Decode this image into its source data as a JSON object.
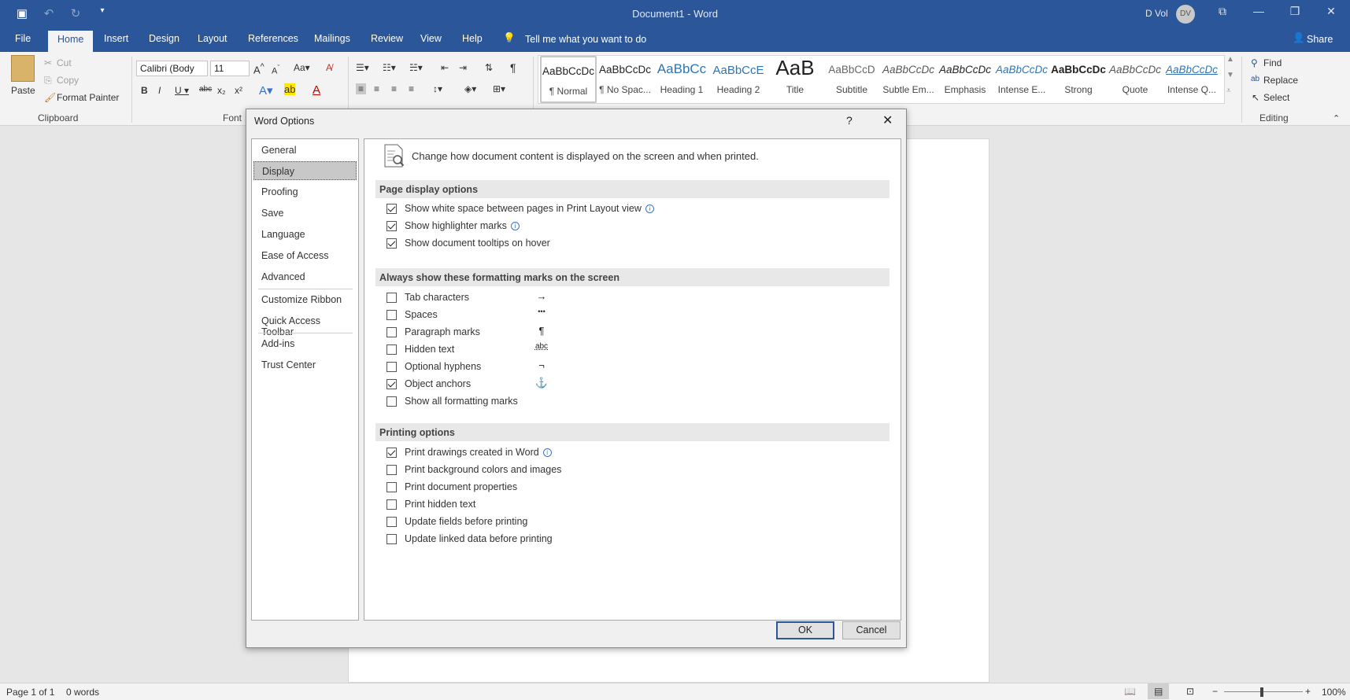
{
  "window": {
    "title": "Document1  -  Word",
    "user_name": "D Vol",
    "user_initials": "DV",
    "qat_icons": [
      "save-icon",
      "undo-icon",
      "redo-icon",
      "customize-qat-icon"
    ],
    "controls": [
      "ribbon-display-icon",
      "minimize-icon",
      "restore-icon",
      "close-icon"
    ]
  },
  "tabs": [
    "File",
    "Home",
    "Insert",
    "Design",
    "Layout",
    "References",
    "Mailings",
    "Review",
    "View",
    "Help"
  ],
  "active_tab": "Home",
  "tell_me": "Tell me what you want to do",
  "share": "Share",
  "ribbon": {
    "clipboard": {
      "paste": "Paste",
      "cut": "Cut",
      "copy": "Copy",
      "format_painter": "Format Painter",
      "label": "Clipboard"
    },
    "font": {
      "name": "Calibri (Body",
      "size": "11",
      "label": "Font"
    },
    "styles": [
      {
        "preview": "AaBbCcDc",
        "name": "¶ Normal"
      },
      {
        "preview": "AaBbCcDc",
        "name": "¶ No Spac..."
      },
      {
        "preview": "AaBbCc",
        "name": "Heading 1"
      },
      {
        "preview": "AaBbCcE",
        "name": "Heading 2"
      },
      {
        "preview": "AaB",
        "name": "Title"
      },
      {
        "preview": "AaBbCcD",
        "name": "Subtitle"
      },
      {
        "preview": "AaBbCcDc",
        "name": "Subtle Em..."
      },
      {
        "preview": "AaBbCcDc",
        "name": "Emphasis"
      },
      {
        "preview": "AaBbCcDc",
        "name": "Intense E..."
      },
      {
        "preview": "AaBbCcDc",
        "name": "Strong"
      },
      {
        "preview": "AaBbCcDc",
        "name": "Quote"
      },
      {
        "preview": "AaBbCcDc",
        "name": "Intense Q..."
      }
    ],
    "editing": {
      "find": "Find",
      "replace": "Replace",
      "select": "Select",
      "label": "Editing"
    }
  },
  "dialog": {
    "title": "Word Options",
    "help": "?",
    "nav": [
      "General",
      "Display",
      "Proofing",
      "Save",
      "Language",
      "Ease of Access",
      "Advanced",
      "Customize Ribbon",
      "Quick Access Toolbar",
      "Add-ins",
      "Trust Center"
    ],
    "selected_nav": "Display",
    "intro": "Change how document content is displayed on the screen and when printed.",
    "sections": {
      "page_display": {
        "title": "Page display options",
        "options": [
          {
            "label": "Show white space between pages in Print Layout view",
            "checked": true,
            "info": true
          },
          {
            "label": "Show highlighter marks",
            "checked": true,
            "info": true
          },
          {
            "label": "Show document tooltips on hover",
            "checked": true,
            "info": false
          }
        ]
      },
      "formatting_marks": {
        "title": "Always show these formatting marks on the screen",
        "options": [
          {
            "label": "Tab characters",
            "checked": false,
            "mark": "→"
          },
          {
            "label": "Spaces",
            "checked": false,
            "mark": "•••"
          },
          {
            "label": "Paragraph marks",
            "checked": false,
            "mark": "¶"
          },
          {
            "label": "Hidden text",
            "checked": false,
            "mark": "abc"
          },
          {
            "label": "Optional hyphens",
            "checked": false,
            "mark": "¬"
          },
          {
            "label": "Object anchors",
            "checked": true,
            "mark": "⚓"
          },
          {
            "label": "Show all formatting marks",
            "checked": false,
            "mark": ""
          }
        ]
      },
      "printing": {
        "title": "Printing options",
        "options": [
          {
            "label": "Print drawings created in Word",
            "checked": true,
            "info": true
          },
          {
            "label": "Print background colors and images",
            "checked": false,
            "info": false
          },
          {
            "label": "Print document properties",
            "checked": false,
            "info": false
          },
          {
            "label": "Print hidden text",
            "checked": false,
            "info": false
          },
          {
            "label": "Update fields before printing",
            "checked": false,
            "info": false
          },
          {
            "label": "Update linked data before printing",
            "checked": false,
            "info": false
          }
        ]
      }
    },
    "ok": "OK",
    "cancel": "Cancel"
  },
  "status": {
    "page": "Page 1 of 1",
    "words": "0 words",
    "zoom": "100%"
  },
  "colors": {
    "accent": "#2b579a",
    "ribbon_bg": "#f3f3f3",
    "doc_bg": "#e6e6e6"
  }
}
